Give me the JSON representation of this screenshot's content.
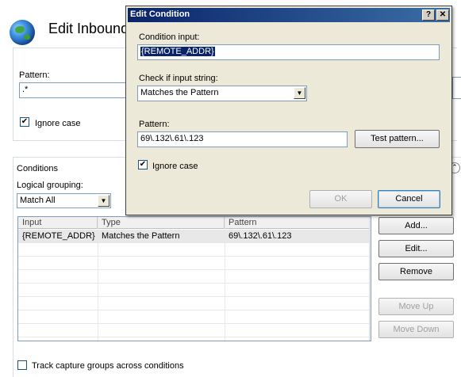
{
  "window": {
    "title": "Edit Inbound",
    "icon": "globe-icon",
    "pattern_label": "Pattern:",
    "pattern_value": ".*",
    "ignore_case_label": "Ignore case",
    "ignore_case_checked": "✔"
  },
  "conditions": {
    "group_label": "Conditions",
    "logical_grouping_label": "Logical grouping:",
    "logical_grouping_value": "Match All",
    "columns": [
      "Input",
      "Type",
      "Pattern"
    ],
    "rows": [
      {
        "input": "{REMOTE_ADDR}",
        "type": "Matches the Pattern",
        "pattern": "69\\.132\\.61\\.123"
      }
    ],
    "buttons": {
      "add": "Add...",
      "edit": "Edit...",
      "remove": "Remove",
      "move_up": "Move Up",
      "move_down": "Move Down"
    },
    "track_capture_label": "Track capture groups across conditions"
  },
  "dialog": {
    "title": "Edit Condition",
    "help_button": "?",
    "close_button": "✕",
    "condition_input_label": "Condition input:",
    "condition_input_value": "{REMOTE_ADDR}",
    "check_label": "Check if input string:",
    "check_value": "Matches the Pattern",
    "pattern_label": "Pattern:",
    "pattern_value": "69\\.132\\.61\\.123",
    "test_pattern_button": "Test pattern...",
    "ignore_case_label": "Ignore case",
    "ignore_case_checked": "✔",
    "ok_button": "OK",
    "cancel_button": "Cancel"
  },
  "colors": {
    "titlebar_start": "#0a246a",
    "titlebar_end": "#3a6ea5",
    "dialog_bg": "#ece9d8",
    "selection": "#0a246a"
  }
}
